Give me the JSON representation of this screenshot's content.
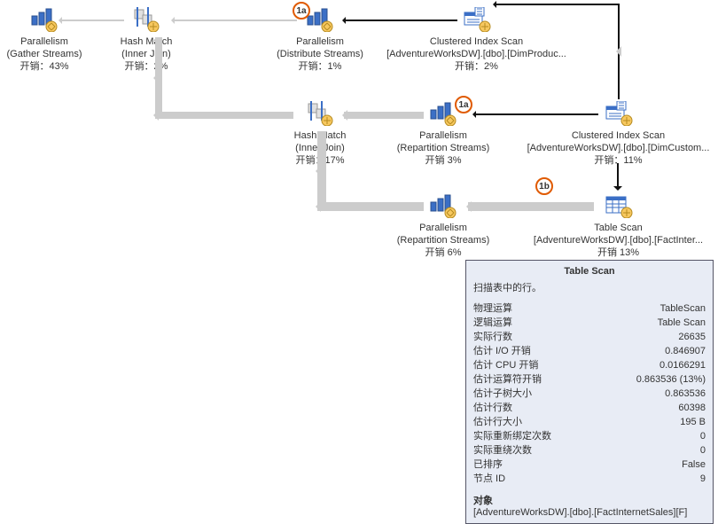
{
  "nodes": {
    "gather": {
      "l1": "Parallelism",
      "l2": "(Gather Streams)",
      "cost": "开销：43%"
    },
    "hm1": {
      "l1": "Hash Match",
      "l2": "(Inner Join)",
      "cost": "开销：2%"
    },
    "dist": {
      "l1": "Parallelism",
      "l2": "(Distribute Streams)",
      "cost": "开销：1%"
    },
    "cis1": {
      "l1": "Clustered Index Scan",
      "l2": "[AdventureWorksDW].[dbo].[DimProduc...",
      "cost": "开销：2%"
    },
    "hm2": {
      "l1": "Hash Match",
      "l2": "(Inner Join)",
      "cost": "开销：17%"
    },
    "rep1": {
      "l1": "Parallelism",
      "l2": "(Repartition Streams)",
      "cost": "开销 3%"
    },
    "cis2": {
      "l1": "Clustered Index Scan",
      "l2": "[AdventureWorksDW].[dbo].[DimCustom...",
      "cost": "开销：11%"
    },
    "rep2": {
      "l1": "Parallelism",
      "l2": "(Repartition Streams)",
      "cost": "开销 6%"
    },
    "tscan": {
      "l1": "Table Scan",
      "l2": "[AdventureWorksDW].[dbo].[FactInter...",
      "cost": "开销 13%"
    }
  },
  "badges": {
    "b1a": "1a",
    "b2a": "1a",
    "b2b": "1b"
  },
  "tooltip": {
    "title": "Table Scan",
    "subtitle": "扫描表中的行。",
    "rows": [
      {
        "k": "物理运算",
        "v": "TableScan"
      },
      {
        "k": "逻辑运算",
        "v": "Table Scan"
      },
      {
        "k": "实际行数",
        "v": "26635"
      },
      {
        "k": "估计 I/O 开销",
        "v": "0.846907"
      },
      {
        "k": "估计 CPU 开销",
        "v": "0.0166291"
      },
      {
        "k": "估计运算符开销",
        "v": "0.863536 (13%)"
      },
      {
        "k": "估计子树大小",
        "v": "0.863536"
      },
      {
        "k": "估计行数",
        "v": "60398"
      },
      {
        "k": "估计行大小",
        "v": "195 B"
      },
      {
        "k": "实际重新绑定次数",
        "v": "0"
      },
      {
        "k": "实际重绕次数",
        "v": "0"
      },
      {
        "k": "已排序",
        "v": "False"
      },
      {
        "k": "节点 ID",
        "v": "9"
      }
    ],
    "objectLabel": "对象",
    "objectValue": "[AdventureWorksDW].[dbo].[FactInternetSales][F]"
  }
}
